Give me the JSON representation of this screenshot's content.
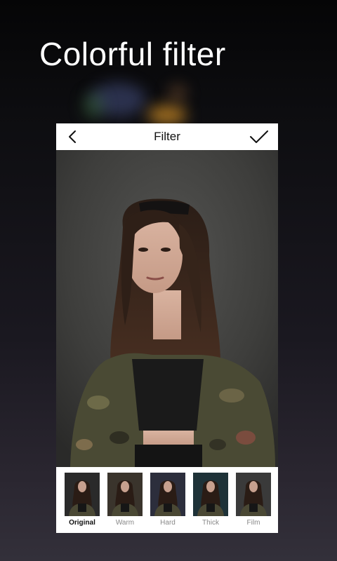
{
  "headline": "Colorful filter",
  "editor": {
    "title": "Filter",
    "back_icon": "chevron-left-icon",
    "confirm_icon": "checkmark-icon",
    "selected_filter": "Original",
    "filters": [
      {
        "label": "Original",
        "tint": "#2a2a2a"
      },
      {
        "label": "Warm",
        "tint": "#3a342c"
      },
      {
        "label": "Hard",
        "tint": "#2c2e3c"
      },
      {
        "label": "Thick",
        "tint": "#1e3238"
      },
      {
        "label": "Film",
        "tint": "#3a3a3a"
      }
    ]
  }
}
